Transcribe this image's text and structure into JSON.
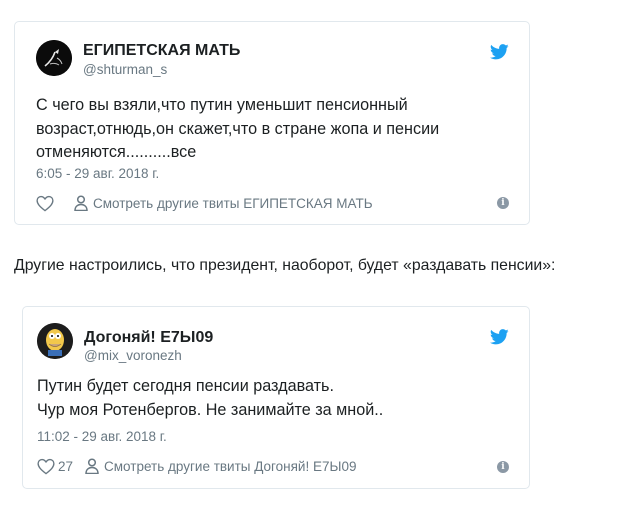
{
  "tweets": [
    {
      "name": "ЕГИПЕТСКАЯ МАТЬ",
      "handle": "@shturman_s",
      "text_lines": [
        "С чего вы взяли,что путин уменьшит пенсионный",
        "возраст,отнюдь,он скажет,что в стране жопа и пенсии",
        "отменяются..........все"
      ],
      "time": "6:05 - 29 авг. 2018 г.",
      "likes": "",
      "more_link": "Смотреть другие твиты ЕГИПЕТСКАЯ МАТЬ"
    },
    {
      "name": "Догоняй! Е7Ы09",
      "handle": "@mix_voronezh",
      "text_lines": [
        "Путин будет сегодня пенсии раздавать.",
        "Чур моя Ротенбергов. Не занимайте за мной.."
      ],
      "time": "11:02 - 29 авг. 2018 г.",
      "likes": "27",
      "more_link": "Смотреть другие твиты Догоняй! Е7Ы09"
    }
  ],
  "caption": "Другие настроились, что президент, наоборот, будет «раздавать пенсии»:",
  "icons": {
    "bird": "twitter-bird-icon",
    "heart": "heart-icon",
    "person": "person-icon",
    "info": "info-icon"
  },
  "colors": {
    "twitter_blue": "#1da1f2",
    "meta_gray": "#697882",
    "border": "#e1e8ed"
  }
}
